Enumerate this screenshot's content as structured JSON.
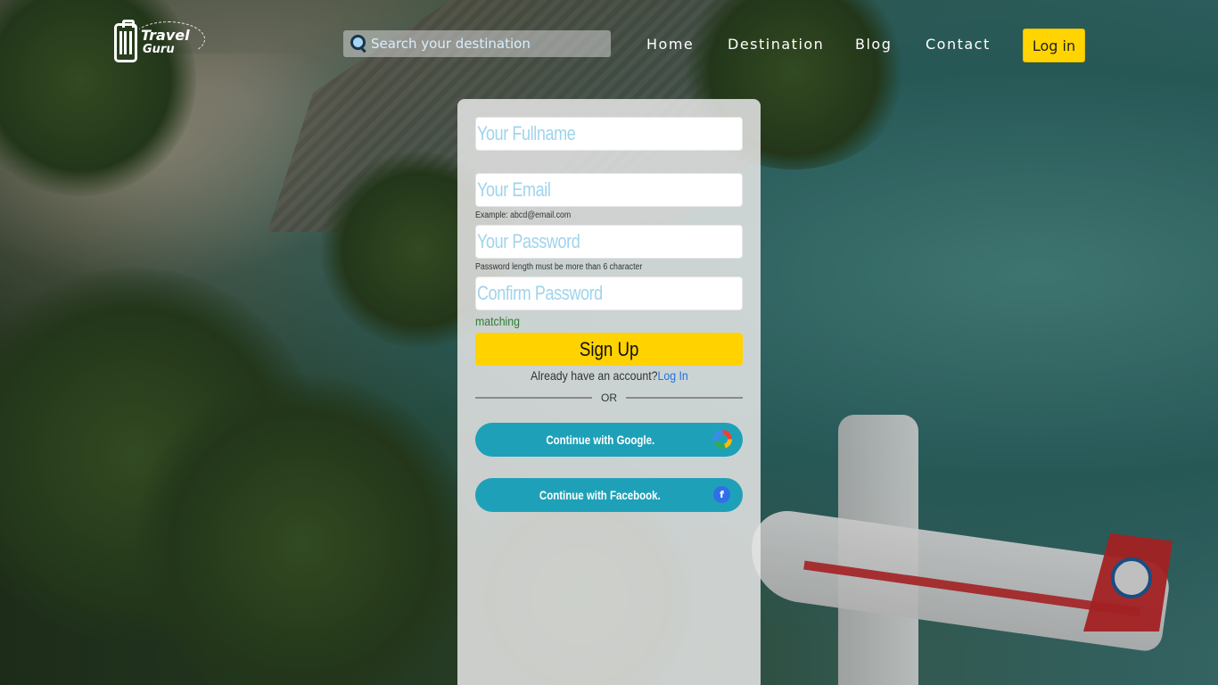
{
  "brand": {
    "line1": "Travel",
    "line2": "Guru"
  },
  "search": {
    "placeholder": "Search your destination",
    "value": ""
  },
  "nav": {
    "home": "Home",
    "destination": "Destination",
    "blog": "Blog",
    "contact": "Contact"
  },
  "header": {
    "login_label": "Log in"
  },
  "form": {
    "fullname_placeholder": "Your Fullname",
    "email_placeholder": "Your Email",
    "email_hint": "Example: abcd@email.com",
    "password_placeholder": "Your Password",
    "password_hint": "Password length must be more than 6 character",
    "confirm_placeholder": "Confirm Password",
    "match_status": "matching",
    "signup_label": "Sign Up",
    "already_text": "Already have an account?",
    "login_link": "Log In",
    "or_text": "OR",
    "google_label": "Continue with Google.",
    "facebook_label": "Continue with Facebook.",
    "facebook_icon_letter": "f"
  },
  "colors": {
    "accent_yellow": "#ffd200",
    "social_button": "#1ea1b8",
    "link_blue": "#1c74e6",
    "match_green": "#2f7d32",
    "placeholder_blue": "#9fd4ec"
  },
  "icons": [
    "luggage-logo-icon",
    "search-icon",
    "google-icon",
    "facebook-icon"
  ]
}
